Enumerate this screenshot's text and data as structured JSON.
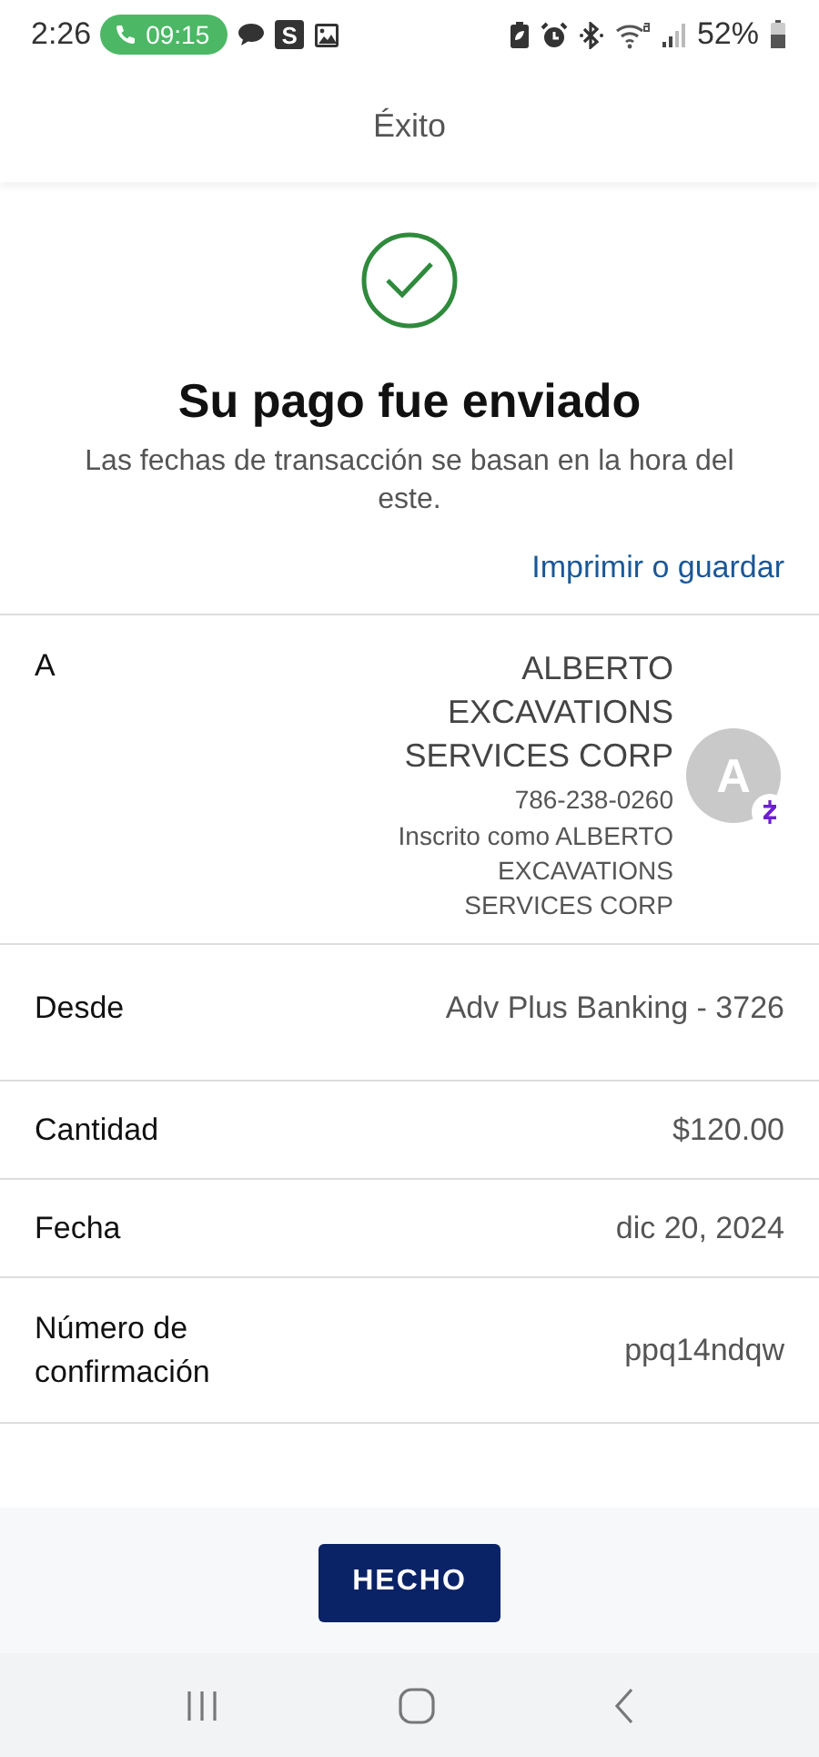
{
  "status_bar": {
    "time": "2:26",
    "call_timer": "09:15",
    "notification_icons": [
      {
        "kind": "chat"
      },
      {
        "kind": "letter",
        "text": "S"
      },
      {
        "kind": "image"
      }
    ],
    "battery": "52%"
  },
  "header": {
    "title": "Éxito"
  },
  "summary": {
    "heading": "Su pago fue enviado",
    "note": "Las fechas de transacción se basan en la hora del este.",
    "print_link": "Imprimir o guardar"
  },
  "recipient": {
    "label": "A",
    "name": "ALBERTO EXCAVATIONS SERVICES CORP",
    "phone": "786-238-0260",
    "enrolled_as": "Inscrito como ALBERTO EXCAVATIONS SERVICES CORP",
    "avatar_letter": "A"
  },
  "details": [
    {
      "label": "Desde",
      "value": "Adv Plus Banking - 3726"
    },
    {
      "label": "Cantidad",
      "value": "$120.00"
    },
    {
      "label": "Fecha",
      "value": "dic 20, 2024"
    },
    {
      "label": "Número de confirmación",
      "value": "ppq14ndqw"
    }
  ],
  "done_button": "HECHO"
}
